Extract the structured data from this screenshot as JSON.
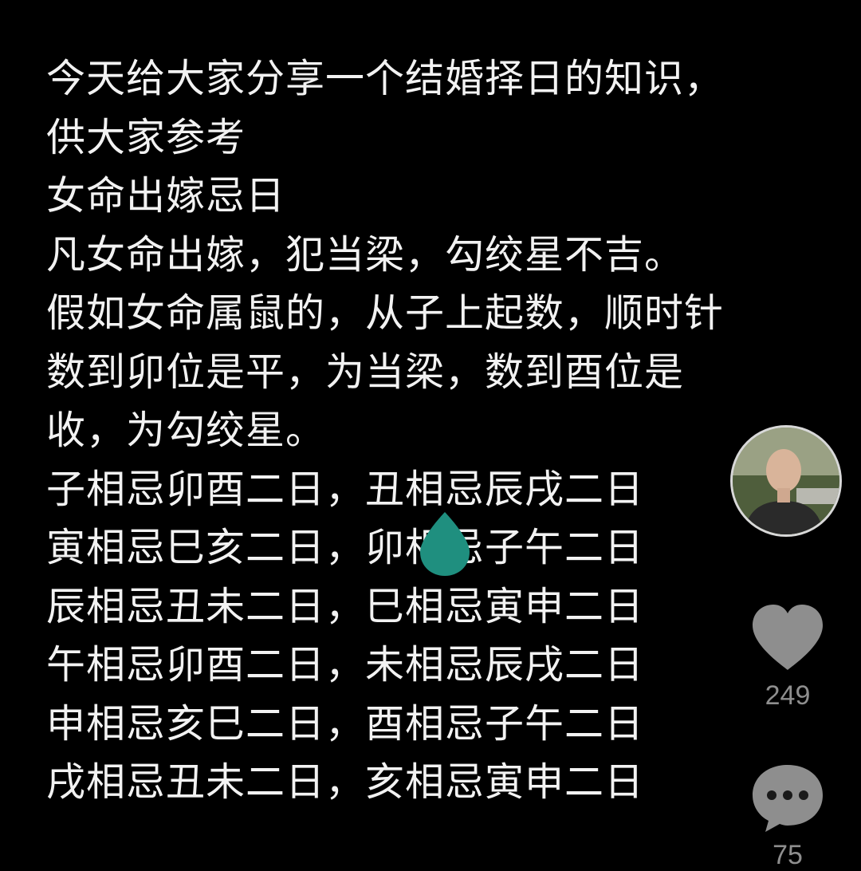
{
  "post": {
    "lines": [
      "今天给大家分享一个结婚择日的知识，",
      "供大家参考",
      "女命出嫁忌日",
      "凡女命出嫁，犯当梁，勾绞星不吉。",
      "假如女命属鼠的，从子上起数，顺时针",
      "数到卯位是平，为当梁，数到酉位是",
      "收，为勾绞星。",
      "子相忌卯酉二日，丑相忌辰戌二日",
      "寅相忌巳亥二日，卯相忌子午二日",
      "辰相忌丑未二日，巳相忌寅申二日",
      "午相忌卯酉二日，未相忌辰戌二日",
      "申相忌亥巳二日，酉相忌子午二日",
      "戌相忌丑未二日，亥相忌寅申二日"
    ]
  },
  "actions": {
    "likes": "249",
    "comments": "75"
  },
  "icons": {
    "avatar": "avatar",
    "like": "heart-icon",
    "comment": "comment-bubble-icon",
    "pin": "location-pin-icon"
  },
  "colors": {
    "background": "#000000",
    "text": "#f2f2f2",
    "icon_gray": "#8e8e8e",
    "pin_teal": "#1f8f7f"
  }
}
